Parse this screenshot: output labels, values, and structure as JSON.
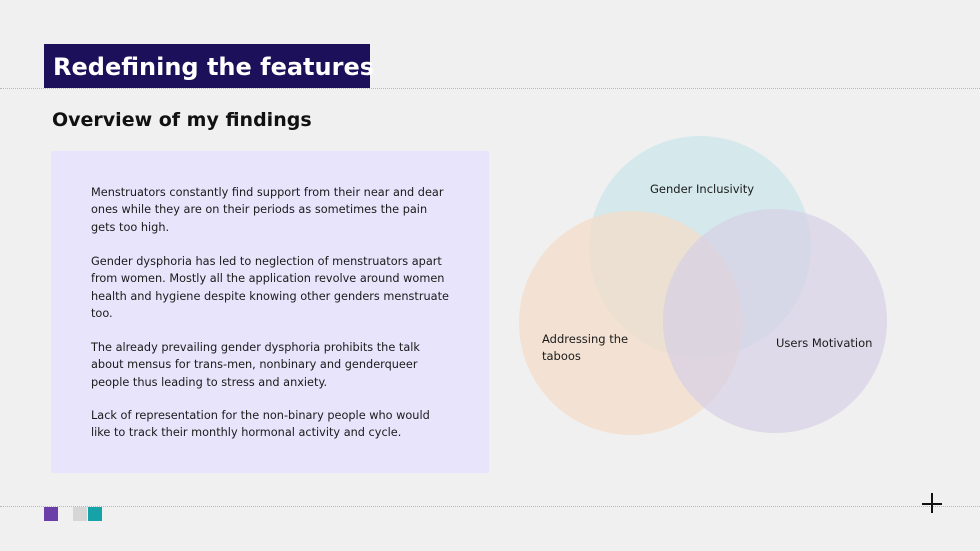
{
  "slide": {
    "title": "Redefining the features",
    "subtitle": "Overview of my findings"
  },
  "findings": {
    "paragraphs": [
      "Menstruators constantly find support from their near and dear ones while they are on their periods as sometimes the pain gets too high.",
      "Gender dysphoria has led to neglection of menstruators apart from women. Mostly all the application revolve around women health and hygiene despite knowing other genders menstruate too.",
      "The already prevailing gender dysphoria prohibits the talk about mensus for trans-men, nonbinary and genderqueer people thus leading to stress and anxiety.",
      "Lack of representation for the non-binary people who would like to track their monthly hormonal activity and cycle."
    ]
  },
  "venn": {
    "top_label": "Gender Inclusivity",
    "left_label_line1": "Addressing the",
    "left_label_line2": "taboos",
    "right_label": "Users Motivation",
    "colors": {
      "top": "#c9e6ea",
      "left": "#f3dcc6",
      "right": "#d5d0e6"
    }
  },
  "theme": {
    "title_bg": "#1b1059",
    "box_bg": "#e8e4fb",
    "square_colors": [
      "#6a3fa8",
      "#d6d6d6",
      "#15a3a8"
    ]
  }
}
